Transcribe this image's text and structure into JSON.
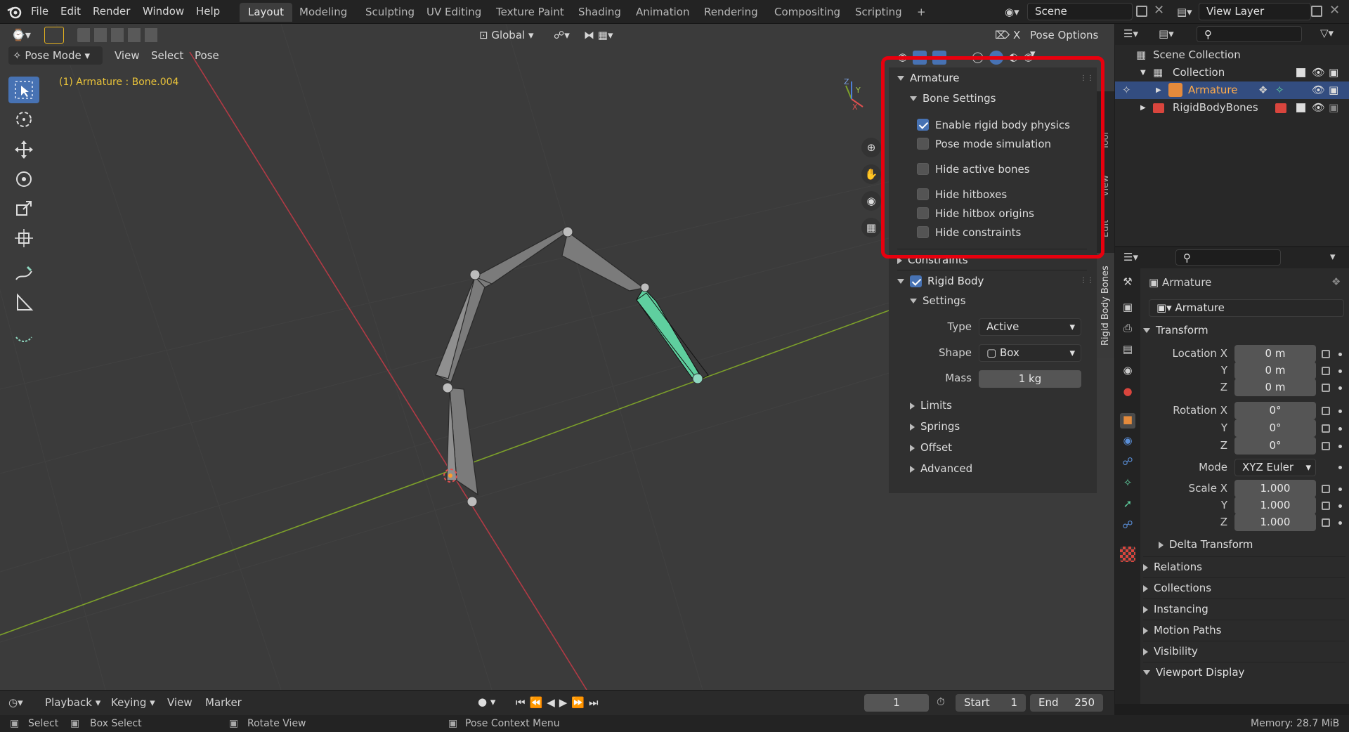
{
  "menu": {
    "items": [
      "File",
      "Edit",
      "Render",
      "Window",
      "Help"
    ],
    "workspaces": [
      "Layout",
      "Modeling",
      "Sculpting",
      "UV Editing",
      "Texture Paint",
      "Shading",
      "Animation",
      "Rendering",
      "Compositing",
      "Scripting"
    ],
    "active_workspace": "Layout",
    "add_tab": "+",
    "scene_label": "Scene",
    "view_layer_label": "View Layer"
  },
  "viewport": {
    "mode": "Pose Mode",
    "menus": [
      "View",
      "Select",
      "Pose"
    ],
    "orientation": "Global",
    "pose_options": "Pose Options",
    "x_mirror": "X",
    "info_text": "(1) Armature : Bone.004",
    "side_tabs": [
      "Rigid Body Bones",
      "Edit",
      "View",
      "Tool"
    ]
  },
  "npanel": {
    "panel_title": "Armature",
    "bone_settings_title": "Bone Settings",
    "checkboxes": [
      {
        "label": "Enable rigid body physics",
        "checked": true
      },
      {
        "label": "Pose mode simulation",
        "checked": false
      },
      {
        "label": "Hide active bones",
        "checked": false
      },
      {
        "label": "Hide hitboxes",
        "checked": false
      },
      {
        "label": "Hide hitbox origins",
        "checked": false
      },
      {
        "label": "Hide constraints",
        "checked": false
      }
    ],
    "constraints_title": "Constraints",
    "rigid_body_title": "Rigid Body",
    "rigid_body_enabled": true,
    "settings_title": "Settings",
    "type_label": "Type",
    "type_value": "Active",
    "shape_label": "Shape",
    "shape_value": "Box",
    "mass_label": "Mass",
    "mass_value": "1 kg",
    "collapsed_sections": [
      "Limits",
      "Springs",
      "Offset",
      "Advanced"
    ]
  },
  "outliner": {
    "scene_collection": "Scene Collection",
    "collection": "Collection",
    "armature": "Armature",
    "rigid_bones": "RigidBodyBones"
  },
  "properties": {
    "object_name": "Armature",
    "data_name": "Armature",
    "transform_title": "Transform",
    "location_label": "Location X",
    "rotation_label": "Rotation X",
    "scale_label": "Scale X",
    "axis_y": "Y",
    "axis_z": "Z",
    "location": [
      "0 m",
      "0 m",
      "0 m"
    ],
    "rotation": [
      "0°",
      "0°",
      "0°"
    ],
    "mode_label": "Mode",
    "mode_value": "XYZ Euler",
    "scale": [
      "1.000",
      "1.000",
      "1.000"
    ],
    "delta_transform": "Delta Transform",
    "sections": [
      "Relations",
      "Collections",
      "Instancing",
      "Motion Paths",
      "Visibility"
    ],
    "viewport_display": "Viewport Display"
  },
  "timeline": {
    "playback": "Playback",
    "keying": "Keying",
    "view": "View",
    "marker": "Marker",
    "current_frame": "1",
    "start_label": "Start",
    "start_value": "1",
    "end_label": "End",
    "end_value": "250"
  },
  "status": {
    "select": "Select",
    "box_select": "Box Select",
    "rotate_view": "Rotate View",
    "context_menu": "Pose Context Menu",
    "memory": "Memory: 28.7 MiB"
  },
  "colors": {
    "accent": "#4772b3",
    "highlight_box": "#e8000e",
    "active_bone": "#5fcf9f",
    "info_text": "#e8c23a"
  }
}
